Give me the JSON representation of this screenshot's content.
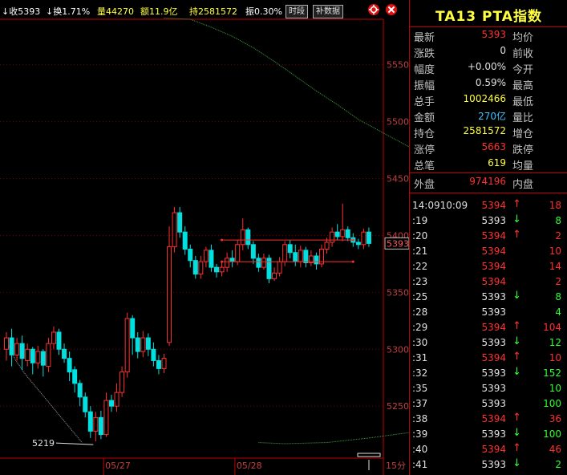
{
  "colors": {
    "up": "#ff3030",
    "down": "#00e0e0",
    "grid": "#7a0000",
    "price_label": "#c04040",
    "yellow": "#ffff40",
    "green": "#30ff30",
    "cyan": "#40c0ff",
    "white": "#e0e0e0"
  },
  "topbar": {
    "close": "↓收5393",
    "turnover": "↓换1.71%",
    "volume": "量44270",
    "amount": "额11.9亿",
    "position": "持2581572",
    "amplitude": "振0.30%",
    "time_btn": "时段",
    "supplement_btn": "补数据",
    "settings_icon": "gear-icon",
    "close_icon": "close-icon"
  },
  "bottom_axis": {
    "ticks": [
      "05/27",
      "05/28"
    ],
    "period": "15分"
  },
  "chart_data": {
    "type": "candlestick",
    "title": "",
    "ylim": [
      5205,
      5590
    ],
    "y_ticks": [
      5550,
      5500,
      5450,
      5400,
      5350,
      5300,
      5250
    ],
    "current_price": 5393,
    "min_label": 5219,
    "x_ticks": [
      "05/27",
      "05/28"
    ],
    "candles": [
      [
        5300,
        5310,
        5290,
        5315
      ],
      [
        5310,
        5295,
        5285,
        5318
      ],
      [
        5295,
        5305,
        5290,
        5310
      ],
      [
        5305,
        5292,
        5282,
        5312
      ],
      [
        5290,
        5300,
        5285,
        5305
      ],
      [
        5300,
        5288,
        5278,
        5302
      ],
      [
        5288,
        5298,
        5283,
        5303
      ],
      [
        5298,
        5286,
        5276,
        5300
      ],
      [
        5285,
        5305,
        5280,
        5310
      ],
      [
        5305,
        5315,
        5300,
        5320
      ],
      [
        5315,
        5300,
        5295,
        5318
      ],
      [
        5300,
        5292,
        5288,
        5305
      ],
      [
        5292,
        5280,
        5272,
        5298
      ],
      [
        5282,
        5270,
        5262,
        5285
      ],
      [
        5270,
        5258,
        5250,
        5273
      ],
      [
        5258,
        5245,
        5240,
        5262
      ],
      [
        5245,
        5228,
        5222,
        5250
      ],
      [
        5228,
        5240,
        5219,
        5245
      ],
      [
        5240,
        5225,
        5221,
        5246
      ],
      [
        5225,
        5255,
        5223,
        5262
      ],
      [
        5255,
        5250,
        5245,
        5260
      ],
      [
        5250,
        5262,
        5245,
        5270
      ],
      [
        5262,
        5280,
        5258,
        5285
      ],
      [
        5280,
        5327,
        5275,
        5332
      ],
      [
        5327,
        5310,
        5295,
        5330
      ],
      [
        5310,
        5298,
        5292,
        5315
      ],
      [
        5298,
        5310,
        5293,
        5316
      ],
      [
        5310,
        5300,
        5294,
        5314
      ],
      [
        5300,
        5290,
        5285,
        5306
      ],
      [
        5290,
        5283,
        5278,
        5295
      ],
      [
        5283,
        5292,
        5279,
        5296
      ],
      [
        5306,
        5390,
        5303,
        5408
      ],
      [
        5390,
        5420,
        5385,
        5425
      ],
      [
        5420,
        5403,
        5398,
        5425
      ],
      [
        5403,
        5388,
        5383,
        5408
      ],
      [
        5388,
        5378,
        5372,
        5392
      ],
      [
        5378,
        5366,
        5362,
        5382
      ],
      [
        5366,
        5377,
        5362,
        5382
      ],
      [
        5377,
        5387,
        5372,
        5390
      ],
      [
        5387,
        5372,
        5368,
        5392
      ],
      [
        5372,
        5368,
        5363,
        5375
      ],
      [
        5368,
        5372,
        5364,
        5377
      ],
      [
        5372,
        5380,
        5368,
        5385
      ],
      [
        5380,
        5377,
        5372,
        5387
      ],
      [
        5377,
        5392,
        5374,
        5396
      ],
      [
        5392,
        5405,
        5387,
        5415
      ],
      [
        5405,
        5392,
        5388,
        5407
      ],
      [
        5392,
        5380,
        5375,
        5395
      ],
      [
        5380,
        5372,
        5368,
        5384
      ],
      [
        5372,
        5380,
        5370,
        5384
      ],
      [
        5380,
        5362,
        5358,
        5383
      ],
      [
        5362,
        5367,
        5360,
        5372
      ],
      [
        5367,
        5377,
        5364,
        5381
      ],
      [
        5377,
        5392,
        5373,
        5395
      ],
      [
        5392,
        5385,
        5380,
        5396
      ],
      [
        5385,
        5377,
        5373,
        5392
      ],
      [
        5377,
        5387,
        5372,
        5391
      ],
      [
        5387,
        5376,
        5372,
        5390
      ],
      [
        5376,
        5382,
        5373,
        5387
      ],
      [
        5382,
        5375,
        5370,
        5385
      ],
      [
        5375,
        5388,
        5372,
        5392
      ],
      [
        5388,
        5394,
        5384,
        5398
      ],
      [
        5394,
        5403,
        5390,
        5407
      ],
      [
        5403,
        5399,
        5396,
        5410
      ],
      [
        5399,
        5405,
        5395,
        5428
      ],
      [
        5405,
        5398,
        5395,
        5408
      ],
      [
        5398,
        5394,
        5390,
        5402
      ],
      [
        5394,
        5392,
        5388,
        5397
      ],
      [
        5392,
        5403,
        5388,
        5406
      ],
      [
        5403,
        5393,
        5390,
        5407
      ]
    ],
    "ma_upper": [
      [
        3,
        5591
      ],
      [
        8,
        5590
      ],
      [
        12,
        5583
      ],
      [
        16,
        5575
      ],
      [
        20,
        5565
      ],
      [
        24,
        5553
      ],
      [
        28,
        5540
      ],
      [
        32,
        5527
      ],
      [
        36,
        5515
      ],
      [
        40,
        5502
      ],
      [
        44,
        5492
      ],
      [
        48,
        5482
      ],
      [
        52,
        5472
      ],
      [
        56,
        5463
      ],
      [
        60,
        5455
      ],
      [
        62,
        5450
      ],
      [
        64,
        5448
      ],
      [
        66,
        5447
      ],
      [
        68,
        5447
      ],
      [
        70,
        5448
      ]
    ],
    "ma_lower": [
      [
        3,
        5218
      ],
      [
        8,
        5217
      ],
      [
        16,
        5218
      ],
      [
        24,
        5222
      ],
      [
        32,
        5227
      ],
      [
        40,
        5230
      ],
      [
        48,
        5233
      ],
      [
        56,
        5234
      ],
      [
        64,
        5234
      ],
      [
        70,
        5233
      ]
    ],
    "ma_left": [
      [
        0,
        5307
      ],
      [
        2,
        5290
      ],
      [
        4,
        5278
      ],
      [
        6,
        5268
      ],
      [
        8,
        5258
      ],
      [
        10,
        5248
      ],
      [
        12,
        5238
      ],
      [
        14,
        5228
      ],
      [
        16,
        5218
      ]
    ],
    "box": {
      "i0": 41,
      "i1": 66,
      "y_top": 5396,
      "y_bottom": 5377
    }
  },
  "panel": {
    "title": "TA13 PTA指数",
    "rows": [
      {
        "label": "最新",
        "value": "5393",
        "vcolor": "up",
        "label2": "均价"
      },
      {
        "label": "涨跌",
        "value": "0",
        "vcolor": "white",
        "label2": "前收"
      },
      {
        "label": "幅度",
        "value": "+0.00%",
        "vcolor": "white",
        "label2": "今开"
      },
      {
        "label": "振幅",
        "value": "0.59%",
        "vcolor": "white",
        "label2": "最高"
      },
      {
        "label": "总手",
        "value": "1002466",
        "vcolor": "yellow",
        "label2": "最低"
      },
      {
        "label": "金额",
        "value": "270亿",
        "vcolor": "cyan",
        "label2": "量比"
      },
      {
        "label": "持仓",
        "value": "2581572",
        "vcolor": "yellow",
        "label2": "增仓"
      },
      {
        "label": "涨停",
        "value": "5663",
        "vcolor": "up",
        "label2": "跌停"
      },
      {
        "label": "总笔",
        "value": "619",
        "vcolor": "yellow",
        "label2": "均量"
      }
    ],
    "outer_label": "外盘",
    "outer_value": "974196",
    "inner_label": "内盘",
    "ticks": [
      {
        "time": "14:09",
        "time2": "10:09",
        "price": "5394",
        "pc": "up",
        "arrow": "↑",
        "ac": "up",
        "vol": "18",
        "vc": "up"
      },
      {
        "time": ":19",
        "price": "5393",
        "pc": "white",
        "arrow": "↓",
        "ac": "green",
        "vol": "8",
        "vc": "green"
      },
      {
        "time": ":20",
        "price": "5394",
        "pc": "up",
        "arrow": "↑",
        "ac": "up",
        "vol": "2",
        "vc": "up"
      },
      {
        "time": ":21",
        "price": "5394",
        "pc": "up",
        "arrow": "",
        "ac": "up",
        "vol": "10",
        "vc": "up"
      },
      {
        "time": ":22",
        "price": "5394",
        "pc": "up",
        "arrow": "",
        "ac": "up",
        "vol": "14",
        "vc": "up"
      },
      {
        "time": ":23",
        "price": "5394",
        "pc": "up",
        "arrow": "",
        "ac": "up",
        "vol": "2",
        "vc": "up"
      },
      {
        "time": ":25",
        "price": "5393",
        "pc": "white",
        "arrow": "↓",
        "ac": "green",
        "vol": "8",
        "vc": "green"
      },
      {
        "time": ":28",
        "price": "5393",
        "pc": "white",
        "arrow": "",
        "ac": "green",
        "vol": "4",
        "vc": "green"
      },
      {
        "time": ":29",
        "price": "5394",
        "pc": "up",
        "arrow": "↑",
        "ac": "up",
        "vol": "104",
        "vc": "up"
      },
      {
        "time": ":30",
        "price": "5393",
        "pc": "white",
        "arrow": "↓",
        "ac": "green",
        "vol": "12",
        "vc": "green"
      },
      {
        "time": ":31",
        "price": "5394",
        "pc": "up",
        "arrow": "↑",
        "ac": "up",
        "vol": "10",
        "vc": "up"
      },
      {
        "time": ":32",
        "price": "5393",
        "pc": "white",
        "arrow": "↓",
        "ac": "green",
        "vol": "152",
        "vc": "green"
      },
      {
        "time": ":35",
        "price": "5393",
        "pc": "white",
        "arrow": "",
        "ac": "green",
        "vol": "10",
        "vc": "green"
      },
      {
        "time": ":37",
        "price": "5393",
        "pc": "white",
        "arrow": "",
        "ac": "green",
        "vol": "100",
        "vc": "green"
      },
      {
        "time": ":38",
        "price": "5394",
        "pc": "up",
        "arrow": "↑",
        "ac": "up",
        "vol": "36",
        "vc": "up"
      },
      {
        "time": ":39",
        "price": "5393",
        "pc": "white",
        "arrow": "↓",
        "ac": "green",
        "vol": "100",
        "vc": "green"
      },
      {
        "time": ":40",
        "price": "5394",
        "pc": "up",
        "arrow": "↑",
        "ac": "up",
        "vol": "46",
        "vc": "up"
      },
      {
        "time": ":41",
        "price": "5393",
        "pc": "white",
        "arrow": "↓",
        "ac": "green",
        "vol": "2",
        "vc": "green"
      }
    ]
  }
}
